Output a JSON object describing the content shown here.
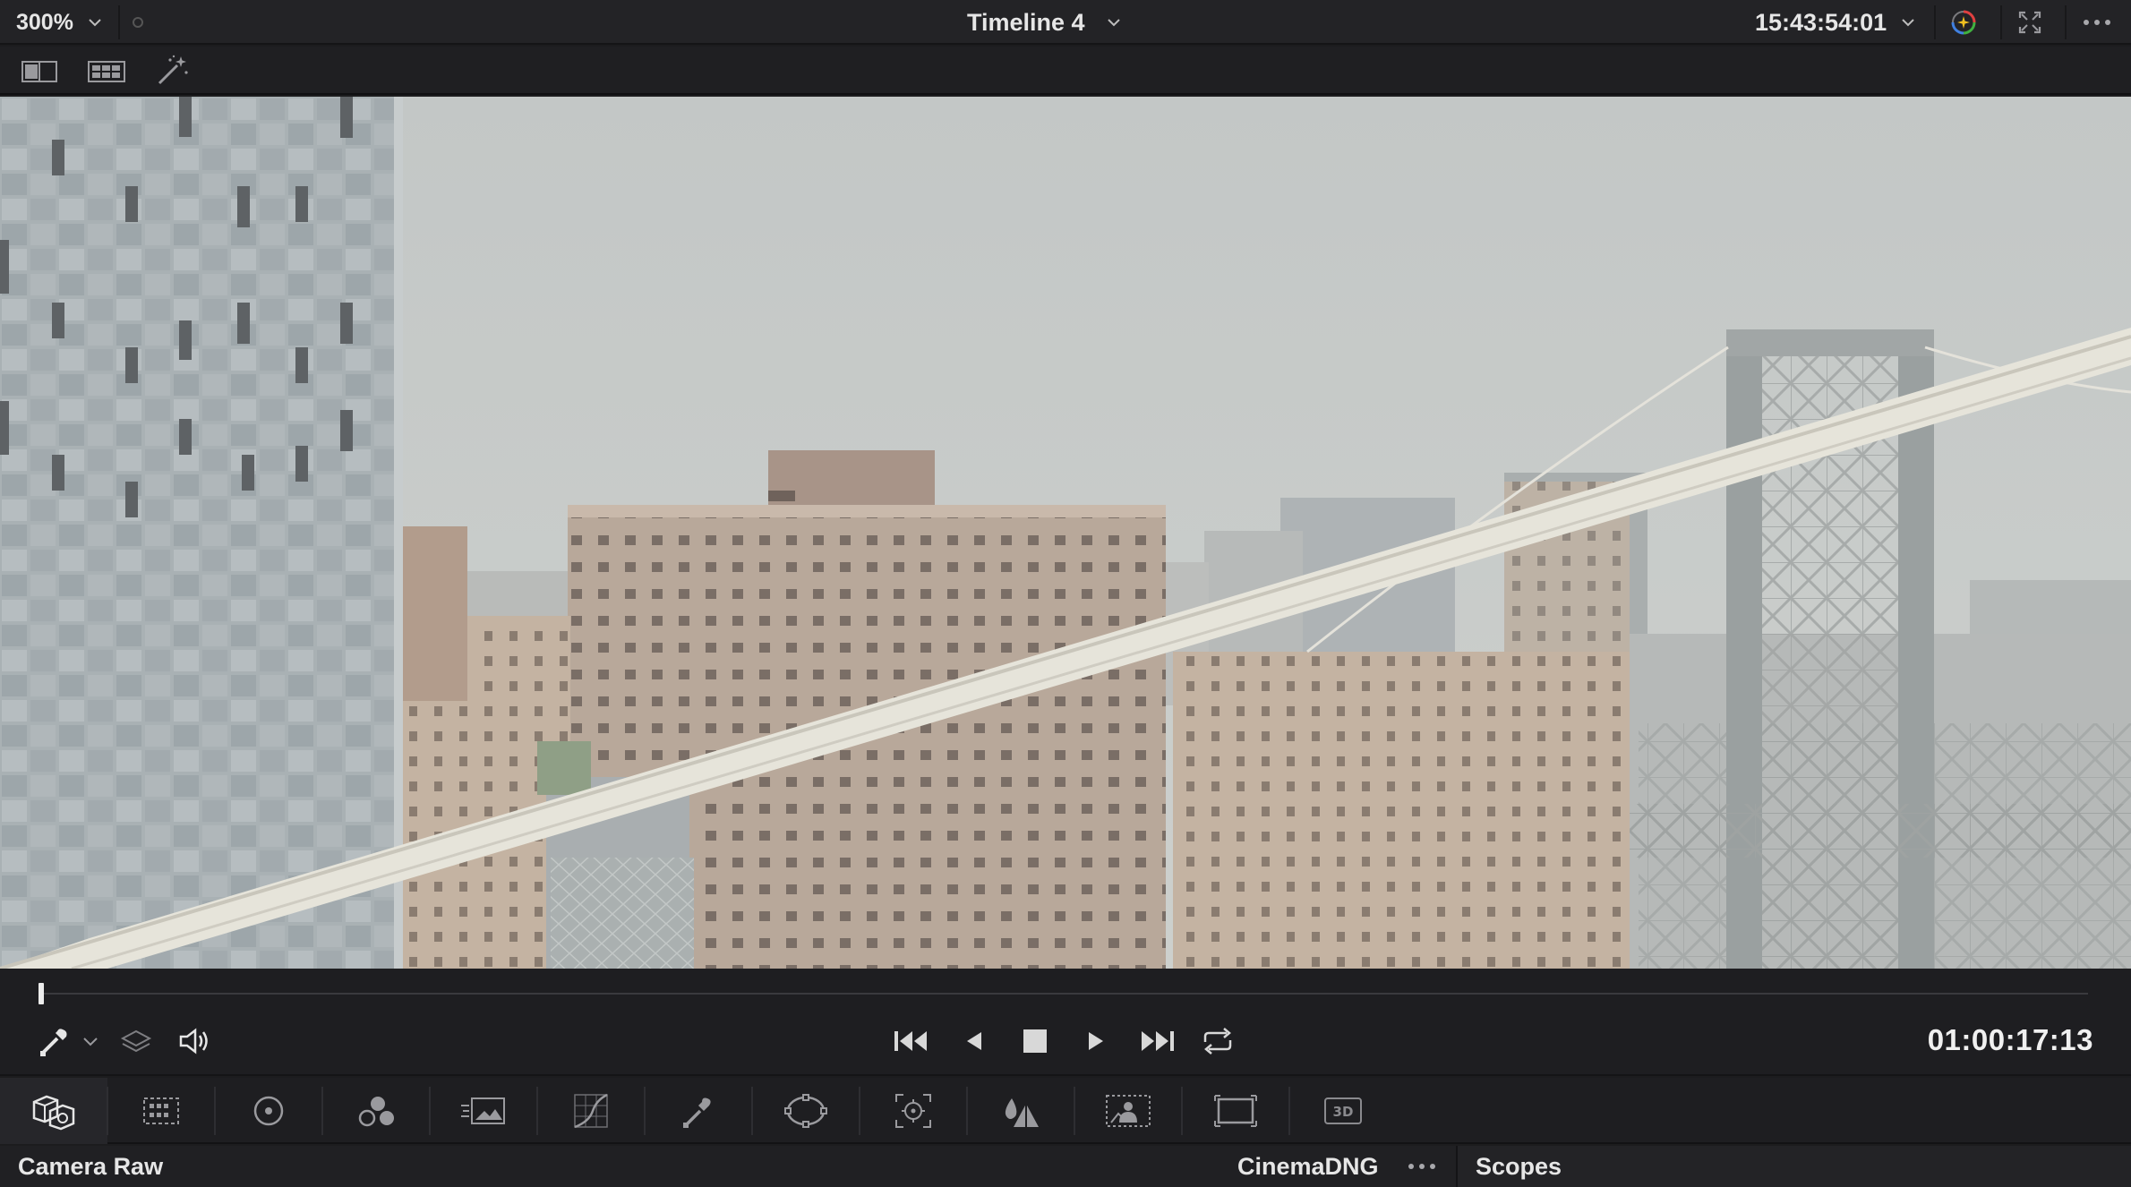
{
  "viewer_header": {
    "zoom_level": "300%",
    "timeline_name": "Timeline 4",
    "record_timecode": "15:43:54:01"
  },
  "transport": {
    "current_timecode": "01:00:17:13",
    "playhead_fraction": 0.0
  },
  "palette": {
    "tools": [
      {
        "id": "camera-raw",
        "icon": "camera-raw-icon",
        "active": true
      },
      {
        "id": "color-match",
        "icon": "color-match-icon",
        "active": false
      },
      {
        "id": "color-wheels",
        "icon": "color-wheels-icon",
        "active": false
      },
      {
        "id": "rgb-mixer",
        "icon": "rgb-mixer-icon",
        "active": false
      },
      {
        "id": "motion-effects",
        "icon": "motion-effects-icon",
        "active": false
      },
      {
        "id": "curves",
        "icon": "curves-icon",
        "active": false
      },
      {
        "id": "qualifier",
        "icon": "qualifier-icon",
        "active": false
      },
      {
        "id": "window",
        "icon": "power-window-icon",
        "active": false
      },
      {
        "id": "tracker",
        "icon": "tracker-icon",
        "active": false
      },
      {
        "id": "blur",
        "icon": "blur-icon",
        "active": false
      },
      {
        "id": "key",
        "icon": "key-icon",
        "active": false
      },
      {
        "id": "sizing",
        "icon": "sizing-icon",
        "active": false
      },
      {
        "id": "3d",
        "icon": "3d-icon",
        "label": "3D",
        "active": false
      }
    ]
  },
  "bottom_bar": {
    "left_panel_title": "Camera Raw",
    "decoder_label": "CinemaDNG",
    "scopes_title": "Scopes"
  },
  "colors": {
    "background": "#1c1c1e",
    "panel": "#232326",
    "text": "#e6e6e6",
    "icon": "#9a9a9e"
  }
}
